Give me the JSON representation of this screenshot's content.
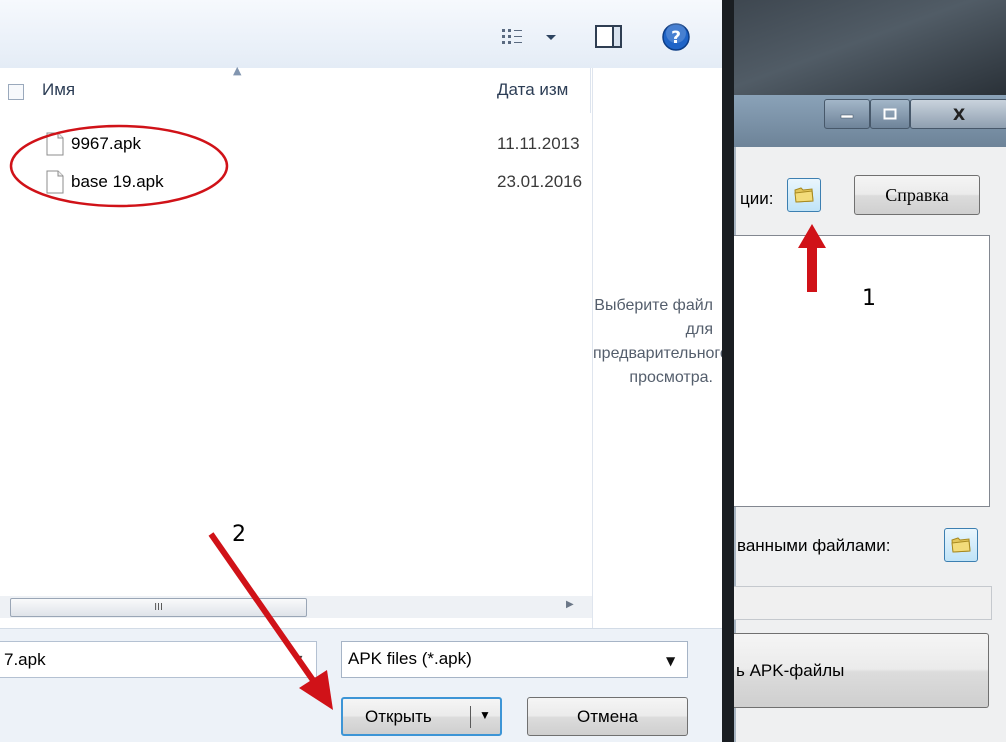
{
  "dialog": {
    "columns": {
      "name": "Имя",
      "date": "Дата изм"
    },
    "files": [
      {
        "name": "9967.apk",
        "date": "11.11.2013"
      },
      {
        "name": "base 19.apk",
        "date": "23.01.2016"
      }
    ],
    "preview_text": "Выберите файл для предварительного просмотра.",
    "scroll_thumb": "III",
    "filename_value": "7.apk",
    "filter_value": "APK files (*.apk)",
    "open_label": "Открыть",
    "cancel_label": "Отмена"
  },
  "app": {
    "label_source": "ции:",
    "help_label": "Справка",
    "label_target": "ванными файлами:",
    "action_label": "ь APK-файлы",
    "window_close": "X"
  },
  "annotations": {
    "step1": "1",
    "step2": "2",
    "color": "#d01218"
  },
  "icons": [
    "view-menu-icon",
    "preview-pane-icon",
    "help-icon",
    "file-icon",
    "folder-icon",
    "minimize-icon",
    "maximize-icon",
    "close-icon"
  ]
}
